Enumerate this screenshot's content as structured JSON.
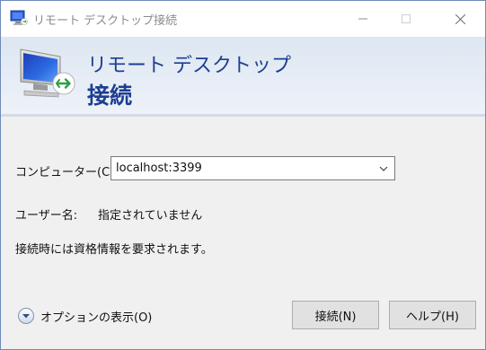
{
  "window": {
    "title": "リモート デスクトップ接続"
  },
  "banner": {
    "line1": "リモート デスクトップ",
    "line2": "接続"
  },
  "form": {
    "computer_label": "コンピューター(C):",
    "computer_value": "localhost:3399",
    "username_label": "ユーザー名:",
    "username_value": "指定されていません",
    "credential_note": "接続時には資格情報を要求されます。"
  },
  "options": {
    "label": "オプションの表示(O)"
  },
  "buttons": {
    "connect": "接続(N)",
    "help": "ヘルプ(H)"
  },
  "icons": {
    "app": "remote-desktop-icon",
    "dropdown": "chevron-down-icon",
    "options": "expand-circle-icon"
  }
}
